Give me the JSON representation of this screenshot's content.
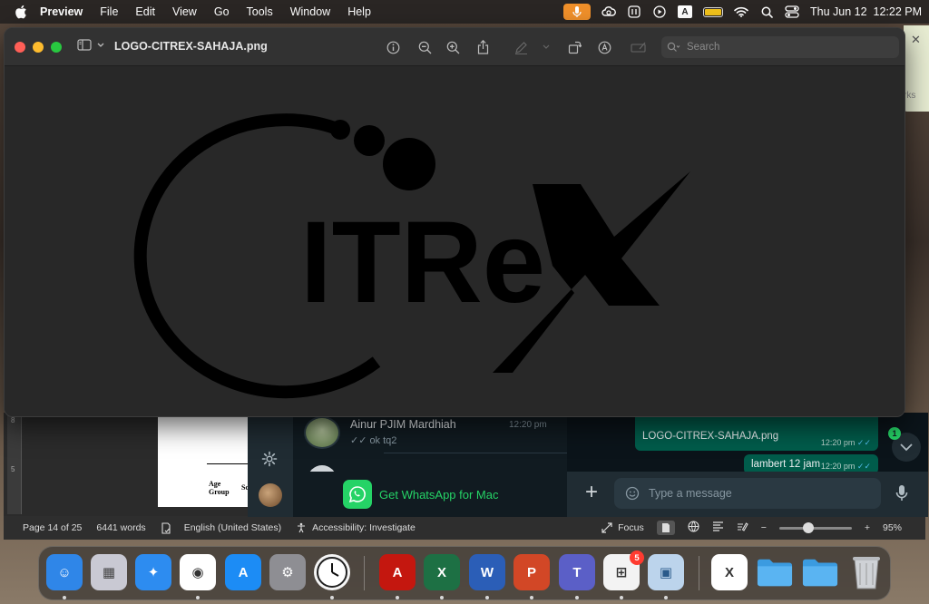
{
  "menubar": {
    "app_name": "Preview",
    "menus": [
      "File",
      "Edit",
      "View",
      "Go",
      "Tools",
      "Window",
      "Help"
    ],
    "clock": "Thu Jun 12  12:22 PM",
    "keyboard_input": "A",
    "icons": [
      "apple-icon",
      "mic-icon",
      "creative-cloud-icon",
      "maps-icon",
      "play-icon",
      "keyboard-input-icon",
      "battery-icon",
      "wifi-icon",
      "search-icon",
      "control-center-icon"
    ]
  },
  "preview": {
    "title": "LOGO-CITREX-SAHAJA.png",
    "search_placeholder": "Search",
    "toolbar_icons": [
      "info-icon",
      "zoom-out-icon",
      "zoom-in-icon",
      "share-icon",
      "markup-pen-icon",
      "chevron-down-icon",
      "rotate-icon",
      "annotate-icon",
      "form-fill-icon"
    ],
    "image_text": "ITRe"
  },
  "background_window": {
    "close_glyph": "✕",
    "fragment_text": "rks"
  },
  "word": {
    "ruler_marks": [
      "8",
      "5"
    ],
    "page_fragment": {
      "line1": "Age",
      "line2": "Group",
      "col2": "Sco"
    },
    "status": {
      "page": "Page 14 of 25",
      "words": "6441 words",
      "language": "English (United States)",
      "accessibility": "Accessibility: Investigate",
      "focus": "Focus",
      "zoom_minus": "−",
      "zoom_plus": "+",
      "zoom_level": "95%",
      "zoom_fraction": 0.4
    }
  },
  "whatsapp": {
    "chat": {
      "name": "Ainur PJIM Mardhiah",
      "time": "12:20 pm",
      "ticks": "✓✓",
      "message": "ok tq2"
    },
    "promo": "Get WhatsApp for Mac",
    "messages": [
      {
        "text": "LOGO-CITREX-SAHAJA.png",
        "time": "12:20 pm",
        "ticks": "✓✓"
      },
      {
        "text": "lambert 12 jam",
        "time": "12:20 pm",
        "ticks": "✓✓"
      }
    ],
    "unread_count": "1",
    "composer_plus": "+",
    "composer_placeholder": "Type a message"
  },
  "dock": {
    "apps": [
      {
        "name": "Finder",
        "icon": "finder-icon",
        "color": "#2f86e8",
        "glyph": "☺",
        "running": true
      },
      {
        "name": "Launchpad",
        "icon": "launchpad-icon",
        "color": "#c9c9d3",
        "glyph": "▦",
        "running": false
      },
      {
        "name": "Safari",
        "icon": "safari-icon",
        "color": "#2d8cf0",
        "glyph": "✦",
        "running": false
      },
      {
        "name": "Chrome",
        "icon": "chrome-icon",
        "color": "#ffffff",
        "glyph": "◉",
        "running": true
      },
      {
        "name": "App Store",
        "icon": "app-store-icon",
        "color": "#1c8cf5",
        "glyph": "A",
        "running": false
      },
      {
        "name": "System Settings",
        "icon": "system-settings-icon",
        "color": "#8e8e93",
        "glyph": "⚙",
        "running": false
      },
      {
        "name": "Clock",
        "icon": "clock-icon",
        "color": "#f5f5f5",
        "glyph": "◷",
        "running": true
      },
      {
        "name": "Acrobat",
        "icon": "acrobat-icon",
        "color": "#c4170f",
        "glyph": "A",
        "running": true
      },
      {
        "name": "Excel",
        "icon": "excel-icon",
        "color": "#1d7044",
        "glyph": "X",
        "running": true
      },
      {
        "name": "Word",
        "icon": "word-icon",
        "color": "#2b5eb7",
        "glyph": "W",
        "running": true
      },
      {
        "name": "PowerPoint",
        "icon": "powerpoint-icon",
        "color": "#d24726",
        "glyph": "P",
        "running": true
      },
      {
        "name": "Teams",
        "icon": "teams-icon",
        "color": "#5b5fc7",
        "glyph": "T",
        "running": true
      },
      {
        "name": "Microsoft Store",
        "icon": "microsoft-store-icon",
        "color": "#f3f3f3",
        "glyph": "⊞",
        "running": true,
        "badge": "5"
      },
      {
        "name": "Preview",
        "icon": "preview-icon",
        "color": "#bcd4ec",
        "glyph": "▣",
        "running": true
      },
      {
        "name": "Excel Document",
        "icon": "excel-document-icon",
        "color": "#ffffff",
        "glyph": "X",
        "running": false
      },
      {
        "name": "Folder",
        "icon": "folder-icon",
        "color": "#4aa8ec",
        "glyph": "",
        "running": false
      },
      {
        "name": "Folder",
        "icon": "folder-icon",
        "color": "#4aa8ec",
        "glyph": "",
        "running": false
      },
      {
        "name": "Trash",
        "icon": "trash-icon",
        "color": "#d0d0d0",
        "glyph": "🗑",
        "running": false
      }
    ]
  }
}
